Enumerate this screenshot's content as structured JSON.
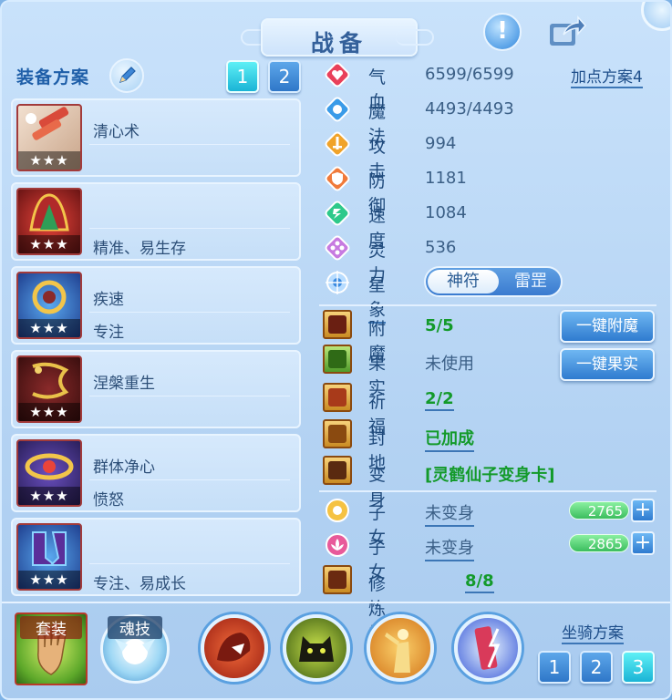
{
  "title": "战备",
  "equip_plan": {
    "label": "装备方案",
    "buttons": [
      "1",
      "2"
    ],
    "active_index": 0
  },
  "equipment": [
    {
      "line1": "清心术",
      "line2": "",
      "stars": "★★★",
      "color": "#e5d6c8"
    },
    {
      "line1": "",
      "line2": "精准、易生存",
      "stars": "★★★",
      "color": "#b42a2a"
    },
    {
      "line1": "疾速",
      "line2": "专注",
      "stars": "★★★",
      "color": "#3b5fbf"
    },
    {
      "line1": "涅槃重生",
      "line2": "",
      "stars": "★★★",
      "color": "#6a1f1f"
    },
    {
      "line1": "群体净心",
      "line2": "愤怒",
      "stars": "★★★",
      "color": "#4c3a8f"
    },
    {
      "line1": "",
      "line2": "专注、易成长",
      "stars": "★★★",
      "color": "#2e6fc9"
    }
  ],
  "stats": [
    {
      "name": "气血",
      "value": "6599/6599",
      "icon": "heart-icon",
      "color": "#e9405a"
    },
    {
      "name": "魔法",
      "value": "4493/4493",
      "icon": "mana-icon",
      "color": "#3a9be8"
    },
    {
      "name": "攻击",
      "value": "994",
      "icon": "sword-icon",
      "color": "#f0a32a"
    },
    {
      "name": "防御",
      "value": "1181",
      "icon": "shield-icon",
      "color": "#f07a3a"
    },
    {
      "name": "速度",
      "value": "1084",
      "icon": "speed-icon",
      "color": "#2ec98a"
    },
    {
      "name": "灵力",
      "value": "536",
      "icon": "spirit-icon",
      "color": "#c77ae0"
    }
  ],
  "add_point": "加点方案4",
  "star_sign": {
    "label": "星象",
    "options": [
      "神符",
      "雷罡"
    ],
    "selected": "神符"
  },
  "enhancements": [
    {
      "name": "附魔",
      "value": "5/5",
      "green": true,
      "underline": false
    },
    {
      "name": "果实",
      "value": "未使用",
      "green": false,
      "underline": false
    },
    {
      "name": "祈福",
      "value": "2/2",
      "green": true,
      "underline": true
    },
    {
      "name": "封地",
      "value": "已加成",
      "green": true,
      "underline": true
    },
    {
      "name": "变身",
      "value": "[灵鹤仙子变身卡]",
      "green": true,
      "underline": false
    }
  ],
  "action_buttons": [
    "一键附魔",
    "一键果实"
  ],
  "children": [
    {
      "name": "子女",
      "value": "未变身",
      "bar": "2765",
      "icon": "sun-icon",
      "color": "#f5c242"
    },
    {
      "name": "子女",
      "value": "未变身",
      "bar": "2865",
      "icon": "lotus-icon",
      "color": "#e85a9a"
    }
  ],
  "cultivation": {
    "name": "修炼觉醒",
    "value": "8/8"
  },
  "bottom": {
    "suit_label": "套装",
    "soul_label": "魂技",
    "mount_label": "坐骑方案",
    "mount_buttons": [
      "1",
      "2",
      "3"
    ],
    "mount_active_index": 2
  }
}
